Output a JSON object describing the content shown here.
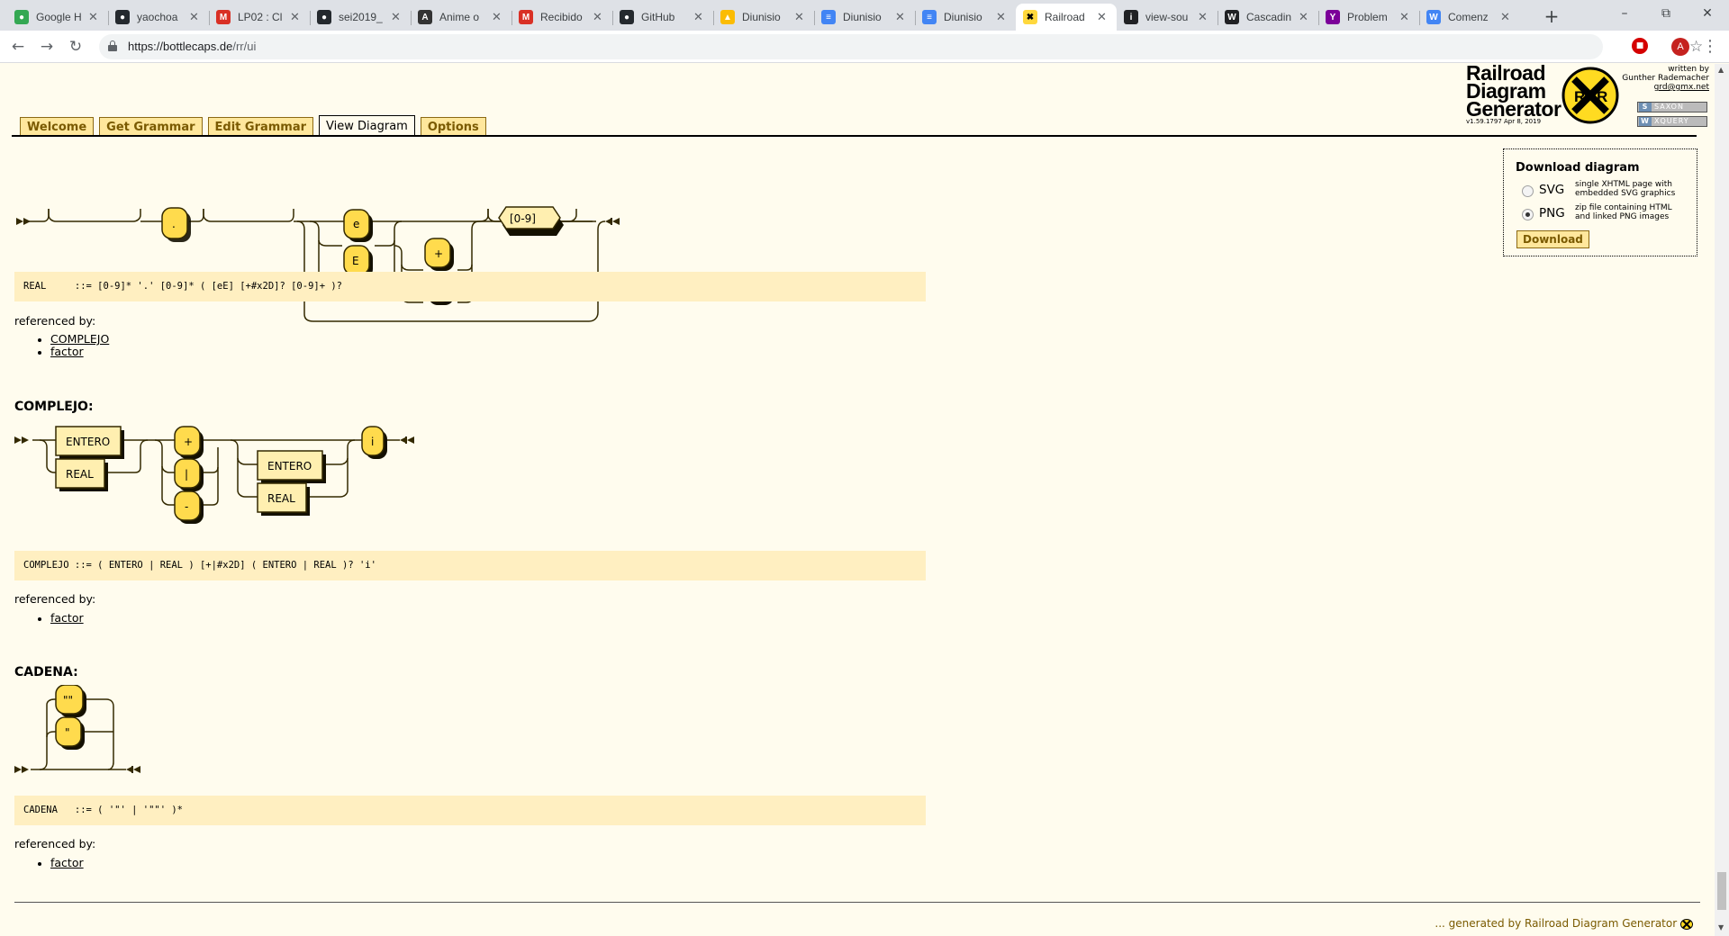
{
  "browser": {
    "tabs": [
      {
        "label": "Google H",
        "icon": "google-maps-icon",
        "color": "#34a853"
      },
      {
        "label": "yaochoa",
        "icon": "github-icon",
        "color": "#24292e"
      },
      {
        "label": "LP02 : Cl",
        "icon": "gmail-icon",
        "color": "#d93025"
      },
      {
        "label": "sei2019_",
        "icon": "github-icon",
        "color": "#24292e"
      },
      {
        "label": "Anime o",
        "icon": "anime-flv-icon",
        "color": "#333333"
      },
      {
        "label": "Recibido",
        "icon": "gmail-icon",
        "color": "#d93025"
      },
      {
        "label": "GitHub",
        "icon": "github-icon",
        "color": "#24292e"
      },
      {
        "label": "Diunisio",
        "icon": "google-drive-icon",
        "color": "#fbbc04"
      },
      {
        "label": "Diunisio",
        "icon": "google-docs-icon",
        "color": "#4285f4"
      },
      {
        "label": "Diunisio",
        "icon": "google-docs-icon",
        "color": "#4285f4"
      },
      {
        "label": "Railroad",
        "icon": "railroad-icon",
        "color": "#ffd83d"
      },
      {
        "label": "view-sou",
        "icon": "info-icon",
        "color": "#202124"
      },
      {
        "label": "Cascadin",
        "icon": "wikipedia-icon",
        "color": "#202124"
      },
      {
        "label": "Problem",
        "icon": "yahoo-icon",
        "color": "#7b0099"
      },
      {
        "label": "Comenz",
        "icon": "w3schools-icon",
        "color": "#4285f4"
      }
    ],
    "url_host": "https://bottlecaps.de",
    "url_path": "/rr/ui",
    "profile_initial": "A"
  },
  "app": {
    "logo_line1": "Railroad",
    "logo_line2": "Diagram",
    "logo_line3": "Generator",
    "version": "v1.59.1797 Apr 8, 2019",
    "credit_line1": "written by",
    "credit_line2": "Gunther Rademacher",
    "credit_email": "grd@gmx.net",
    "badge1": "SAXON",
    "badge2": "XQUERY",
    "nav": [
      "Welcome",
      "Get Grammar",
      "Edit Grammar",
      "View Diagram",
      "Options"
    ],
    "active_nav": "View Diagram"
  },
  "diagrams": {
    "real": {
      "tokens": [
        ".",
        "e",
        "E",
        "+",
        "-",
        "[0-9]"
      ],
      "ebnf": "REAL     ::= [0-9]* '.' [0-9]* ( [eE] [+#x2D]? [0-9]+ )?",
      "refby_label": "referenced by:",
      "refs": [
        "COMPLEJO",
        "factor"
      ]
    },
    "complejo": {
      "heading": "COMPLEJO:",
      "tokens": [
        "ENTERO",
        "REAL",
        "+",
        "|",
        "-",
        "ENTERO",
        "REAL",
        "i"
      ],
      "ebnf": "COMPLEJO ::= ( ENTERO | REAL ) [+|#x2D] ( ENTERO | REAL )? 'i'",
      "refby_label": "referenced by:",
      "refs": [
        "factor"
      ]
    },
    "cadena": {
      "heading": "CADENA:",
      "tokens": [
        "\"\"",
        "\""
      ],
      "ebnf": "CADENA   ::= ( '\"' | '\"\"' )*",
      "refby_label": "referenced by:",
      "refs": [
        "factor"
      ]
    }
  },
  "download": {
    "title": "Download diagram",
    "options": [
      {
        "label": "SVG",
        "desc1": "single XHTML page with",
        "desc2": "embedded SVG graphics",
        "selected": false
      },
      {
        "label": "PNG",
        "desc1": "zip file containing HTML",
        "desc2": "and linked PNG images",
        "selected": true
      }
    ],
    "button": "Download"
  },
  "footer": {
    "text": "... generated by Railroad Diagram Generator"
  },
  "colors": {
    "token_fill": "#ffdb4d",
    "nonterminal_fill": "#ffefb0",
    "line": "#332900",
    "page_bg": "#fffcee",
    "ebnf_bg": "#ffefc1"
  }
}
